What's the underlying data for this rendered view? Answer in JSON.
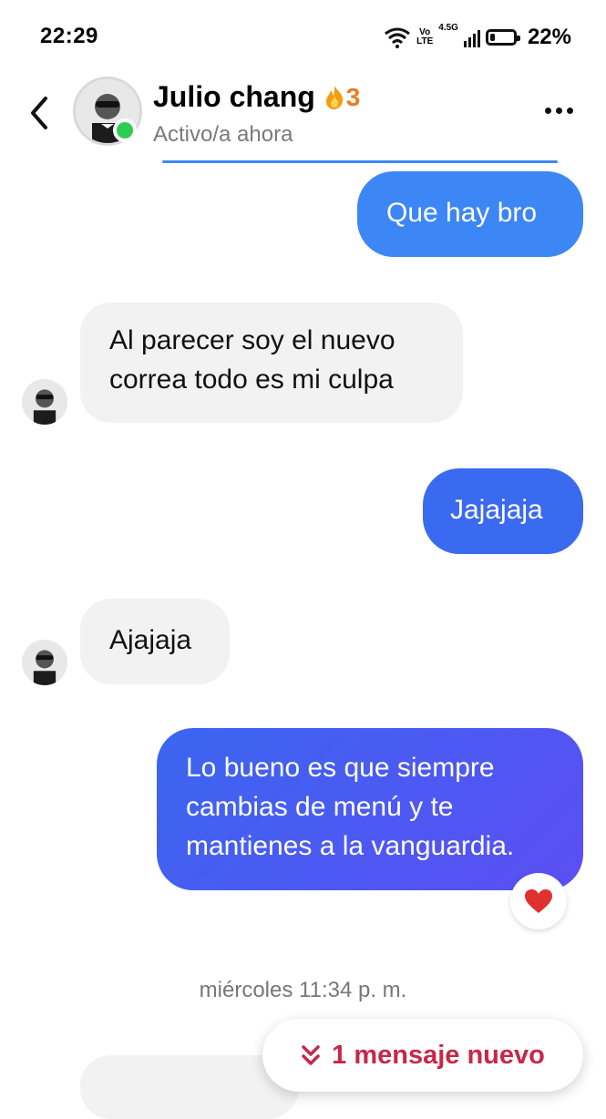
{
  "status_bar": {
    "time": "22:29",
    "network_top": "Vo",
    "network_bottom": "LTE",
    "network_type": "4.5G",
    "battery_percent": "22%",
    "battery_level": 0.22
  },
  "header": {
    "contact_name": "Julio chang",
    "streak_count": "3",
    "presence": "Activo/a ahora"
  },
  "messages": [
    {
      "id": "m1",
      "direction": "outgoing",
      "text": "Que hay bro"
    },
    {
      "id": "m2",
      "direction": "incoming",
      "lines": [
        "Al parecer soy el nuevo",
        "correa todo es mi culpa"
      ]
    },
    {
      "id": "m3",
      "direction": "outgoing",
      "text": "Jajajaja"
    },
    {
      "id": "m4",
      "direction": "incoming",
      "text": "Ajajaja"
    },
    {
      "id": "m5",
      "direction": "outgoing",
      "lines": [
        "Lo bueno es que siempre",
        "cambias de menú y te",
        "mantienes a la vanguardia."
      ],
      "reaction": "heart-icon"
    }
  ],
  "date_separator": "miércoles 11:34 p. m.",
  "new_message_pill": "1 mensaje nuevo",
  "colors": {
    "bubble_blue_light": "#3d86f5",
    "bubble_blue_mid": "#3a66f0",
    "bubble_purple": "#5c4ef3",
    "incoming_bubble": "#f2f2f2",
    "new_message_text": "#c8264a",
    "online": "#2ecc52",
    "streak": "#e67e22"
  }
}
